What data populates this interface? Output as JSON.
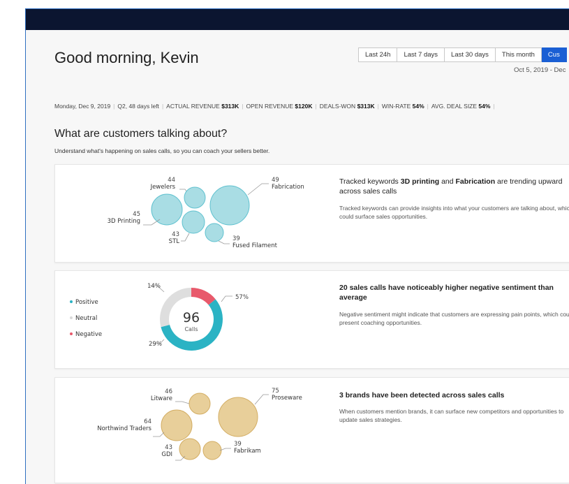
{
  "header": {
    "greeting": "Good morning, Kevin",
    "range_buttons": [
      "Last 24h",
      "Last 7 days",
      "Last 30 days",
      "This month",
      "Cus"
    ],
    "active_range": 4,
    "date_range": "Oct 5, 2019 - Dec"
  },
  "stats": {
    "date": "Monday, Dec 9, 2019",
    "quarter": "Q2, 48 days left",
    "actual_revenue_label": "ACTUAL REVENUE",
    "actual_revenue_value": "$313K",
    "open_revenue_label": "OPEN REVENUE",
    "open_revenue_value": "$120K",
    "deals_won_label": "DEALS-WON",
    "deals_won_value": "$313K",
    "win_rate_label": "WIN-RATE",
    "win_rate_value": "54%",
    "avg_deal_label": "AVG. DEAL SIZE",
    "avg_deal_value": "54%"
  },
  "section": {
    "title": "What are customers talking about?",
    "subtitle": "Understand what's happening on sales calls, so you can coach your sellers better."
  },
  "cards": {
    "keywords": {
      "title_pre": "Tracked keywords ",
      "title_b1": "3D printing",
      "title_mid": " and ",
      "title_b2": "Fabrication",
      "title_post": " are trending upward across sales calls",
      "desc": "Tracked keywords can provide insights into what your customers are talking about, which could surface sales opportunities.",
      "color_fill": "#a9dde4",
      "color_stroke": "#5fc1cf",
      "bubbles": [
        {
          "label": "Jewelers",
          "value": "44"
        },
        {
          "label": "Fabrication",
          "value": "49"
        },
        {
          "label": "3D Printing",
          "value": "45"
        },
        {
          "label": "STL",
          "value": "43"
        },
        {
          "label": "Fused Filament",
          "value": "39"
        }
      ]
    },
    "sentiment": {
      "title": "20 sales calls have noticeably higher negative sentiment than average",
      "desc": "Negative sentiment might indicate that customers are expressing pain points, which could present coaching opportunities.",
      "total": "96",
      "total_label": "Calls",
      "legend": [
        {
          "label": "Positive",
          "color": "#2bb3c4"
        },
        {
          "label": "Neutral",
          "color": "#d9d9d9"
        },
        {
          "label": "Negative",
          "color": "#e8596b"
        }
      ],
      "slices": [
        {
          "name": "Positive",
          "pct": 57,
          "label": "57%",
          "color": "#2bb3c4"
        },
        {
          "name": "Neutral",
          "pct": 29,
          "label": "29%",
          "color": "#dedede"
        },
        {
          "name": "Negative",
          "pct": 14,
          "label": "14%",
          "color": "#e8596b"
        }
      ]
    },
    "brands": {
      "title": "3 brands have been detected across sales calls",
      "desc": "When customers mention brands, it can surface new competitors and opportunities to update sales strategies.",
      "color_fill": "#e8cf9a",
      "color_stroke": "#d3ad63",
      "bubbles": [
        {
          "label": "Litware",
          "value": "46"
        },
        {
          "label": "Proseware",
          "value": "75"
        },
        {
          "label": "Northwind Traders",
          "value": "64"
        },
        {
          "label": "GDI",
          "value": "43"
        },
        {
          "label": "Fabrikam",
          "value": "39"
        }
      ]
    }
  }
}
